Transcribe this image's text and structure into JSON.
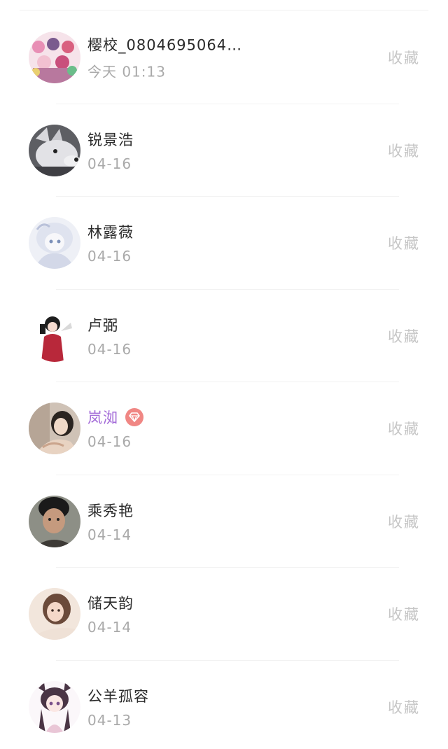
{
  "items": [
    {
      "name": "樱校_0804695064…",
      "date": "今天 01:13",
      "action": "收藏",
      "vip": false
    },
    {
      "name": "锐景浩",
      "date": "04-16",
      "action": "收藏",
      "vip": false
    },
    {
      "name": "林露薇",
      "date": "04-16",
      "action": "收藏",
      "vip": false
    },
    {
      "name": "卢弼",
      "date": "04-16",
      "action": "收藏",
      "vip": false
    },
    {
      "name": "岚洳",
      "date": "04-16",
      "action": "收藏",
      "vip": true
    },
    {
      "name": "乘秀艳",
      "date": "04-14",
      "action": "收藏",
      "vip": false
    },
    {
      "name": "储天韵",
      "date": "04-14",
      "action": "收藏",
      "vip": false
    },
    {
      "name": "公羊孤容",
      "date": "04-13",
      "action": "收藏",
      "vip": false
    }
  ],
  "colors": {
    "vip_name": "#a36ad8",
    "vip_badge": "#f08784",
    "action_text": "#c6c6c6",
    "date_text": "#a9a9a9"
  }
}
